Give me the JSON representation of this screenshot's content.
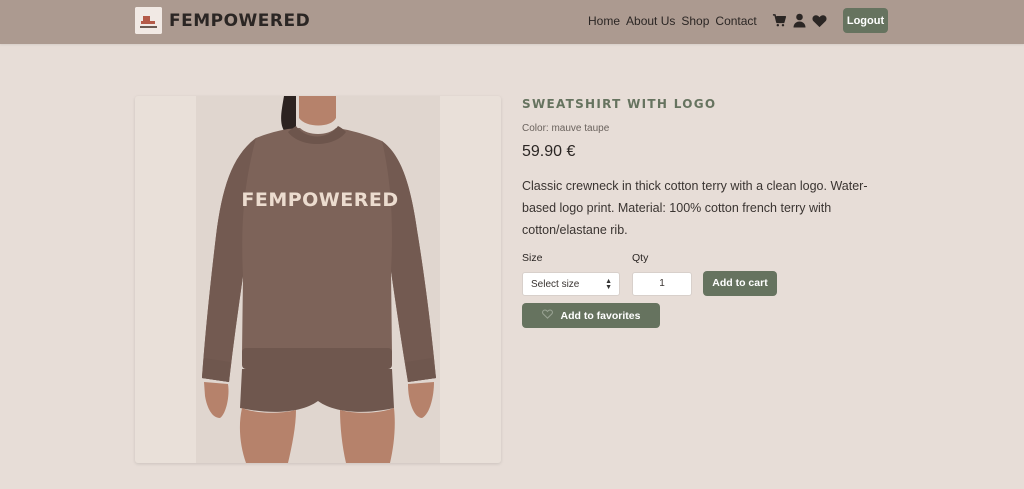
{
  "header": {
    "brand": "FEMPOWERED",
    "nav": [
      "Home",
      "About Us",
      "Shop",
      "Contact"
    ],
    "icons": [
      "cart-icon",
      "user-icon",
      "heart-icon"
    ],
    "logout_label": "Logout"
  },
  "image": {
    "print_text": "FEMPOWERED"
  },
  "product": {
    "title": "SWEATSHIRT WITH LOGO",
    "color_line": "Color: mauve taupe",
    "price": "59.90 €",
    "description": "Classic crewneck in thick cotton terry with a clean logo. Water-based logo print. Material: 100% cotton french terry with cotton/elastane rib.",
    "size_label": "Size",
    "size_placeholder": "Select size",
    "qty_label": "Qty",
    "qty_value": "1",
    "add_to_cart": "Add to cart",
    "add_to_favorites": "Add to favorites"
  },
  "colors": {
    "header_bg": "#ac9a90",
    "page_bg": "#e7ddd7",
    "accent": "#66735f"
  }
}
